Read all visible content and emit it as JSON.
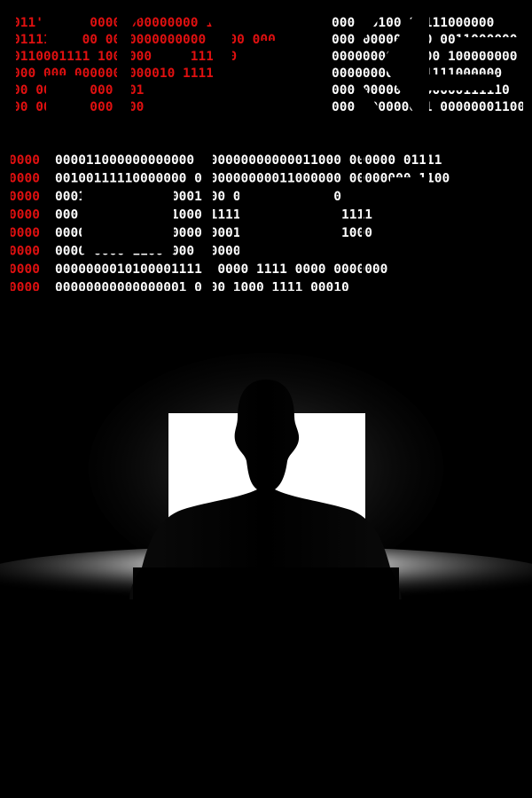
{
  "title_words": {
    "top": {
      "red": [
        "011' 1000 00000000000000 1",
        "01111 00000 0000000000000 1000 000",
        "0110001111 100 000 100 111000",
        "000 000 0000000000010 1111",
        "00 000 00 000 001",
        "00 00 000 000 100"
      ],
      "white": [
        "000010100 11111000000",
        "0000000000000 0011000000",
        "00000000000000 100000000",
        "00000000100 1111000000",
        "00000000010 00000111110",
        "0000000000001 000000011000"
      ]
    },
    "bottom": {
      "red": [
        "0000",
        "0000",
        "0000",
        "0000",
        "0000",
        "0000",
        "0000",
        "0000"
      ],
      "white": [
        "000011000000000000 000000000000011000 000000 01111",
        "00100111110000000 0000000000011000000 00000000 1100",
        "0001 00000000000001000 000000000 1100",
        "000 00000000010100001111 0000 000000 1111",
        "0000 0000000000000000001 0000 000001 1000",
        "0000 0000 1100 000 00000000",
        "00000000101000011111 0000 1111 0000 0000000",
        "00000000000000001 0000 1000 1111 00010"
      ]
    }
  },
  "colors": {
    "background": "#000000",
    "binary_red": "#e01010",
    "binary_white": "#ffffff",
    "monitor_glow": "#ffffff"
  },
  "figure": "silhouette-at-monitor"
}
